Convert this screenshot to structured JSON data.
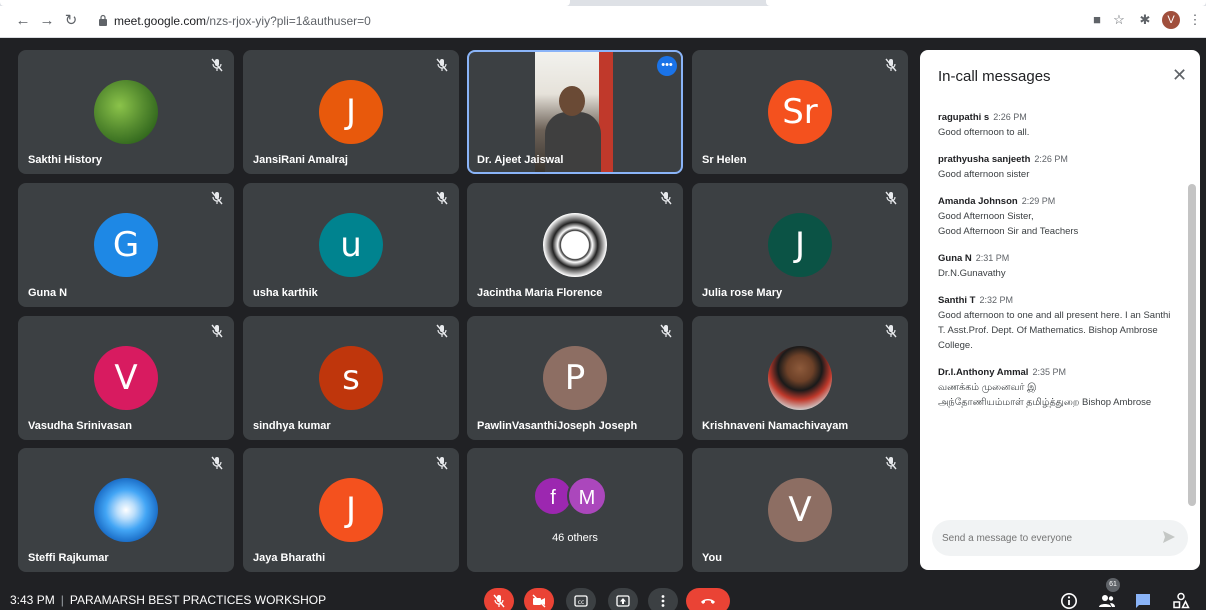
{
  "browser": {
    "url_host": "meet.google.com",
    "url_path": "/nzs-rjox-yiy?pli=1&authuser=0",
    "profile_initial": "V"
  },
  "participants": [
    {
      "name": "Sakthi History",
      "kind": "photo-plant"
    },
    {
      "name": "JansiRani Amalraj",
      "initial": "J",
      "color": "#e8590c"
    },
    {
      "name": "Dr. Ajeet Jaiswal",
      "kind": "video"
    },
    {
      "name": "Sr Helen",
      "initial": "Sr",
      "color": "#f4511e"
    },
    {
      "name": "Guna N",
      "initial": "G",
      "color": "#1e88e5"
    },
    {
      "name": "usha karthik",
      "initial": "u",
      "color": "#00838f"
    },
    {
      "name": "Jacintha Maria Florence",
      "kind": "photo-emblem"
    },
    {
      "name": "Julia rose Mary",
      "initial": "J",
      "color": "#0b5345"
    },
    {
      "name": "Vasudha Srinivasan",
      "initial": "V",
      "color": "#d81b60"
    },
    {
      "name": "sindhya kumar",
      "initial": "s",
      "color": "#bf360c"
    },
    {
      "name": "PawlinVasanthiJoseph Joseph",
      "initial": "P",
      "color": "#8d6e63"
    },
    {
      "name": "Krishnaveni Namachivayam",
      "kind": "photo-person"
    },
    {
      "name": "Steffi Rajkumar",
      "kind": "photo-flower"
    },
    {
      "name": "Jaya Bharathi",
      "initial": "J",
      "color": "#f4511e"
    },
    {
      "name": "46 others",
      "kind": "others",
      "initials": [
        "f",
        "M"
      ],
      "colors": [
        "#9c27b0",
        "#ab47bc"
      ]
    },
    {
      "name": "You",
      "initial": "V",
      "color": "#8d6e63"
    }
  ],
  "panel": {
    "title": "In-call messages",
    "messages": [
      {
        "sender": "ragupathi s",
        "time": "2:26 PM",
        "text": "Good ofternoon to all."
      },
      {
        "sender": "prathyusha sanjeeth",
        "time": "2:26 PM",
        "text": "Good afternoon sister"
      },
      {
        "sender": "Amanda Johnson",
        "time": "2:29 PM",
        "text": "Good Afternoon Sister,\nGood Afternoon Sir and Teachers"
      },
      {
        "sender": "Guna N",
        "time": "2:31 PM",
        "text": "Dr.N.Gunavathy"
      },
      {
        "sender": "Santhi T",
        "time": "2:32 PM",
        "text": "Good afternoon to one and all present here. I an Santhi T. Asst.Prof. Dept. Of Mathematics. Bishop Ambrose College."
      },
      {
        "sender": "Dr.I.Anthony Ammal",
        "time": "2:35 PM",
        "text": "வணக்கம் முனைவர் இ\nஅந்தோணியம்மாள் தமிழ்த்துறை Bishop Ambrose"
      }
    ],
    "input_placeholder": "Send a message to everyone"
  },
  "footer": {
    "time": "3:43 PM",
    "meeting_name": "PARAMARSH BEST PRACTICES WORKSHOP",
    "participant_count": "61"
  },
  "colors": {
    "end_call": "#ea4335",
    "accent": "#1a73e8"
  }
}
